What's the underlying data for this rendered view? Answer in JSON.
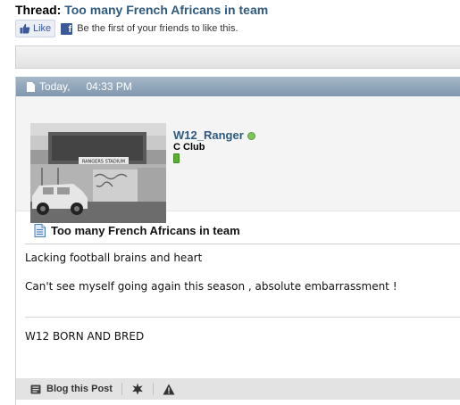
{
  "thread": {
    "prefix": "Thread:",
    "title": "Too many French Africans in team"
  },
  "facebook": {
    "like_label": "Like",
    "social_text": "Be the first of your friends to like this.",
    "brand_color": "#3b5998"
  },
  "post": {
    "date": "Today,",
    "time": "04:33 PM",
    "user": {
      "name": "W12_Ranger",
      "title": "C Club",
      "online_status_icon": "online-dot-icon",
      "reputation_icon": "reputation-bar-icon"
    },
    "title": "Too many French Africans in team",
    "body": [
      "Lacking football brains and heart",
      "Can't see myself going again this season , absolute embarrassment !"
    ],
    "signature": "W12 BORN AND BRED",
    "avatar_sign_text": "RANGERS STADIUM"
  },
  "footer": {
    "blog_label": "Blog this Post",
    "icons": [
      "blog-icon",
      "star-icon",
      "warning-icon"
    ]
  },
  "colors": {
    "link": "#2f5a80",
    "header_bar": "#8fa5ba",
    "online": "#7fc45a"
  }
}
